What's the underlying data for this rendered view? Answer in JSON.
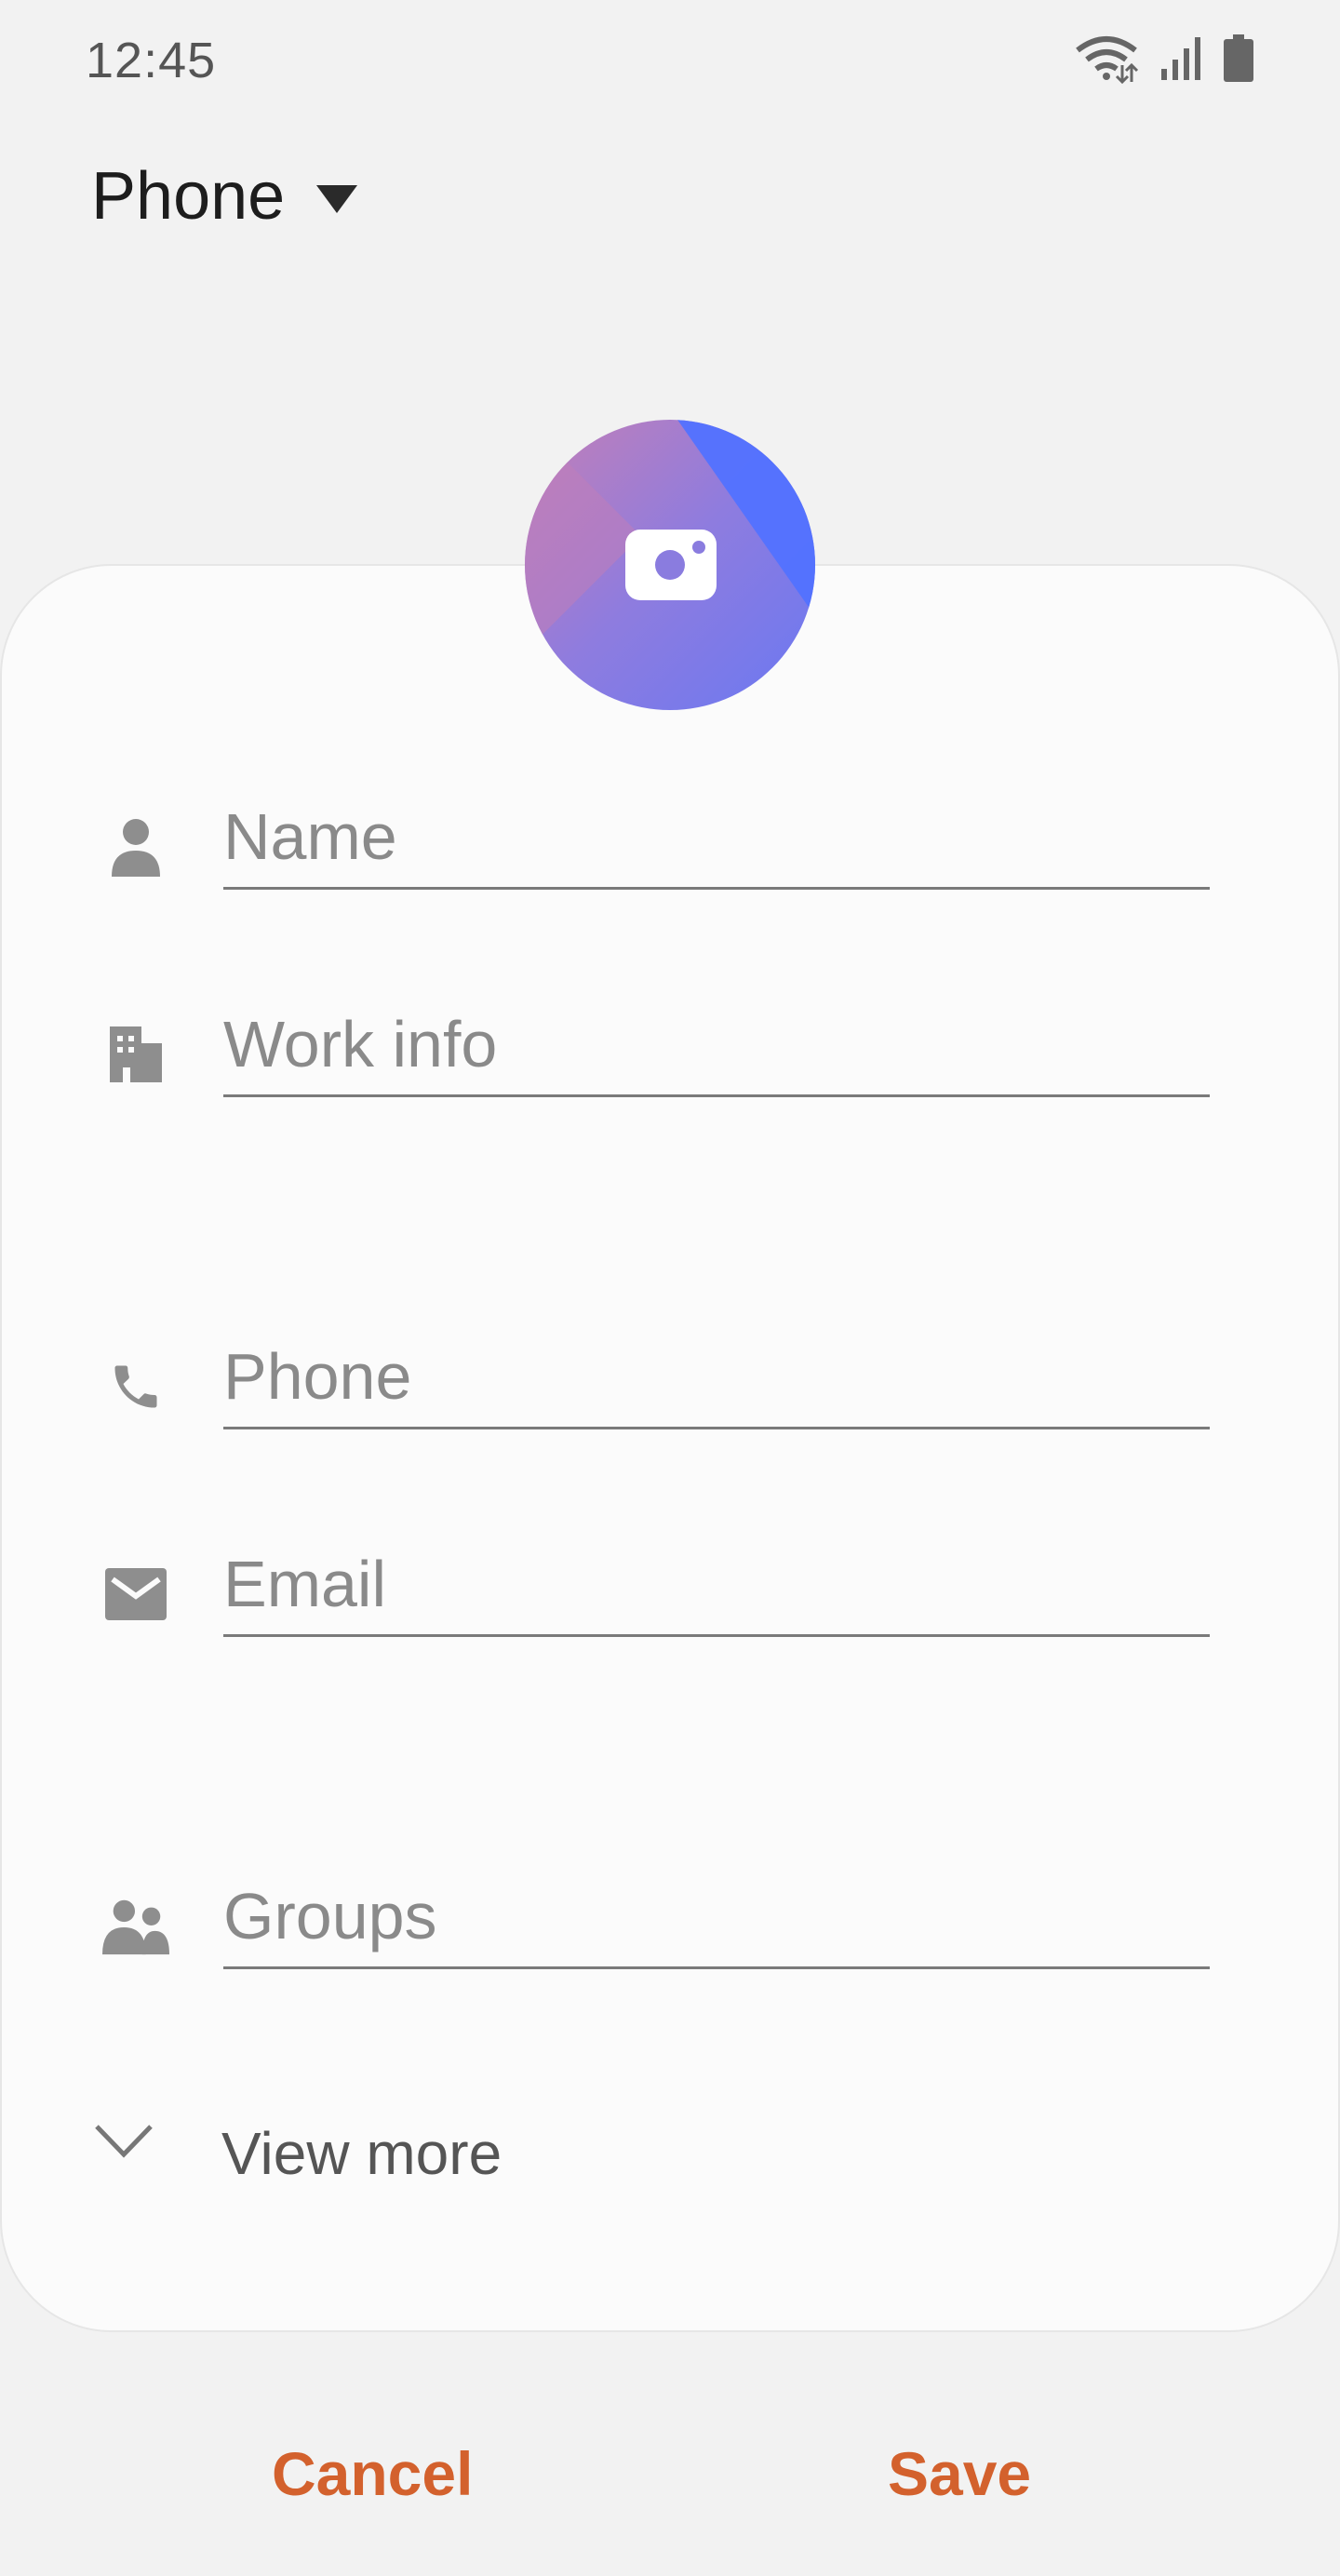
{
  "status_bar": {
    "time": "12:45",
    "icons": [
      "wifi-icon",
      "signal-icon",
      "battery-icon"
    ]
  },
  "header": {
    "storage_label": "Phone",
    "dropdown_icon": "dropdown-triangle-icon"
  },
  "avatar": {
    "icon": "camera-icon"
  },
  "fields": {
    "name": {
      "placeholder": "Name",
      "value": "",
      "icon": "person-icon"
    },
    "work": {
      "placeholder": "Work info",
      "value": "",
      "icon": "building-icon"
    },
    "phone": {
      "placeholder": "Phone",
      "value": "",
      "icon": "phone-icon"
    },
    "email": {
      "placeholder": "Email",
      "value": "",
      "icon": "email-icon"
    },
    "groups": {
      "placeholder": "Groups",
      "value": "",
      "icon": "groups-icon"
    }
  },
  "view_more": {
    "label": "View more",
    "icon": "chevron-down-icon"
  },
  "actions": {
    "cancel": "Cancel",
    "save": "Save"
  },
  "colors": {
    "accent": "#d3612d",
    "background": "#f2f2f2",
    "card": "#fbfbfb",
    "avatar_blue": "#5272ff",
    "avatar_pink": "#c07eba"
  }
}
